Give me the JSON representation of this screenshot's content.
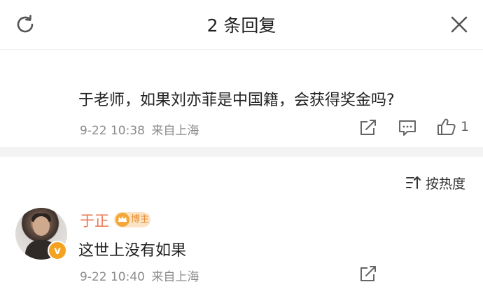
{
  "header": {
    "title": "2 条回复",
    "refresh_icon": "refresh-icon",
    "close_icon": "close-icon"
  },
  "post": {
    "text": "于老师，如果刘亦菲是中国籍，会获得奖金吗?",
    "time": "9-22 10:38",
    "source": "来自上海",
    "like_count": "1",
    "icons": [
      "share-icon",
      "comment-icon",
      "like-icon"
    ]
  },
  "sort": {
    "label": "按热度",
    "icon": "sort-icon"
  },
  "reply": {
    "username": "于正",
    "badge": "博主",
    "verified_mark": "v",
    "text": "这世上没有如果",
    "time": "9-22 10:40",
    "source": "来自上海",
    "icons": [
      "share-icon"
    ]
  },
  "colors": {
    "username": "#eb7350",
    "meta": "#8b8b8b",
    "badge_bg": "#fbe4c6",
    "verified": "#f4a21f"
  }
}
